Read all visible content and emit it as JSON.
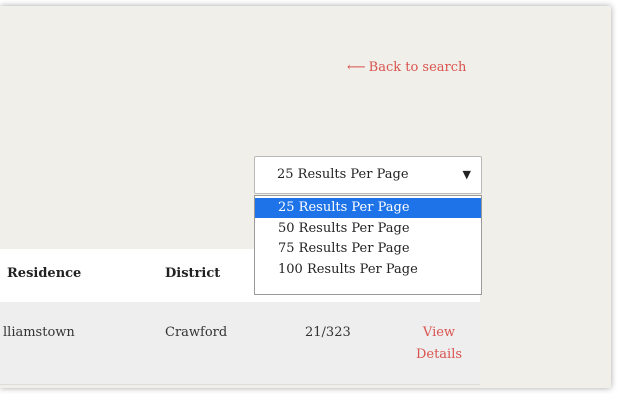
{
  "header": {
    "back_link": "Back to search"
  },
  "results_select": {
    "value": "25 Results Per Page",
    "options": [
      "25 Results Per Page",
      "50 Results Per Page",
      "75 Results Per Page",
      "100 Results Per Page"
    ],
    "selected_index": 0
  },
  "table": {
    "headers": {
      "residence": "Residence",
      "district": "District"
    },
    "rows": [
      {
        "residence": "lliamstown",
        "district": "Crawford",
        "number": "21/323",
        "action": "View Details"
      }
    ]
  },
  "colors": {
    "accent": "#d9534f",
    "selected": "#1e73e8",
    "background": "#f1efea"
  }
}
